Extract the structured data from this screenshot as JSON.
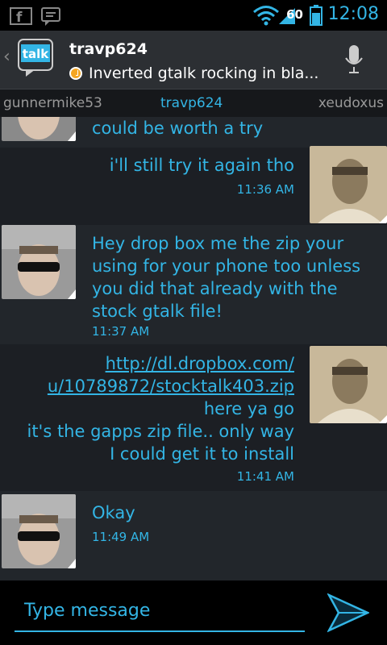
{
  "status_bar": {
    "time": "12:08",
    "battery_percent": "60"
  },
  "header": {
    "title": "travp624",
    "status": "Inverted gtalk rocking in bla...",
    "logo": "talk"
  },
  "tabs": [
    {
      "label": "gunnermike53"
    },
    {
      "label": "travp624"
    },
    {
      "label": "xeudoxus"
    }
  ],
  "messages": [
    {
      "direction": "in",
      "lines": [
        "could be worth a try"
      ],
      "time": ""
    },
    {
      "direction": "out",
      "lines": [
        "i'll still try it again tho"
      ],
      "time": "11:36 AM"
    },
    {
      "direction": "in",
      "lines": [
        "Hey drop box me the zip your",
        "using for your phone too unless",
        "you did that already with the",
        "stock gtalk file!"
      ],
      "time": "11:37 AM"
    },
    {
      "direction": "out",
      "link_lines": [
        "http://dl.dropbox.com/",
        "u/10789872/stocktalk403.zip"
      ],
      "lines": [
        "here ya go",
        "it's the gapps zip file.. only way",
        "I could get it to install"
      ],
      "time": "11:41 AM"
    },
    {
      "direction": "in",
      "lines": [
        "Okay"
      ],
      "time": "11:49 AM"
    }
  ],
  "composer": {
    "placeholder": "Type message"
  },
  "colors": {
    "accent": "#33b5e5",
    "background": "#1c1f24",
    "presence": "#f5a623"
  }
}
